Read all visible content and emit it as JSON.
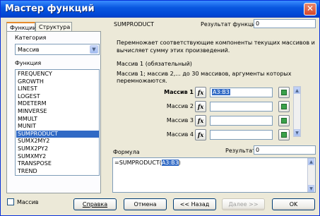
{
  "window": {
    "title": "Мастер функций",
    "close": "✕"
  },
  "tabs": [
    {
      "label": "Функции"
    },
    {
      "label": "Структура"
    }
  ],
  "left": {
    "category_label": "Категория",
    "category_value": "Массив",
    "function_label": "Функция",
    "functions": [
      "FREQUENCY",
      "GROWTH",
      "LINEST",
      "LOGEST",
      "MDETERM",
      "MINVERSE",
      "MMULT",
      "MUNIT",
      "SUMPRODUCT",
      "SUMX2MY2",
      "SUMX2PY2",
      "SUMXMY2",
      "TRANSPOSE",
      "TREND"
    ],
    "selected_index": 8
  },
  "right": {
    "func_name": "SUMPRODUCT",
    "result_label": "Результат функции",
    "result_value": "0",
    "description": [
      "Перемножает соответствующие компоненты текущих массивов и",
      "вычисляет сумму этих произведений."
    ],
    "arg_title": "Массив 1 (обязательный)",
    "arg_desc": [
      "Массив 1; массив 2,... до 30 массивов, аргументы которых",
      "перемножаются."
    ],
    "args": [
      {
        "label": "Массив 1",
        "value": "A3:B3"
      },
      {
        "label": "Массив 2",
        "value": ""
      },
      {
        "label": "Массив 3",
        "value": ""
      },
      {
        "label": "Массив 4",
        "value": ""
      }
    ],
    "fx": "fx",
    "formula_label": "Формула",
    "result2_label": "Результат",
    "result2_value": "0",
    "formula_prefix": "=SUMPRODUCT(",
    "formula_arg": "A3:B3",
    "formula_suffix": ")"
  },
  "footer": {
    "array_checkbox": "Массив",
    "help": "Справка",
    "cancel": "Отмена",
    "back": "<< Назад",
    "next": "Далее >>",
    "ok": "OK"
  },
  "colors": {
    "selection": "#316ac5",
    "titlebar": "#0a58e0",
    "dialog": "#ece9d8"
  }
}
